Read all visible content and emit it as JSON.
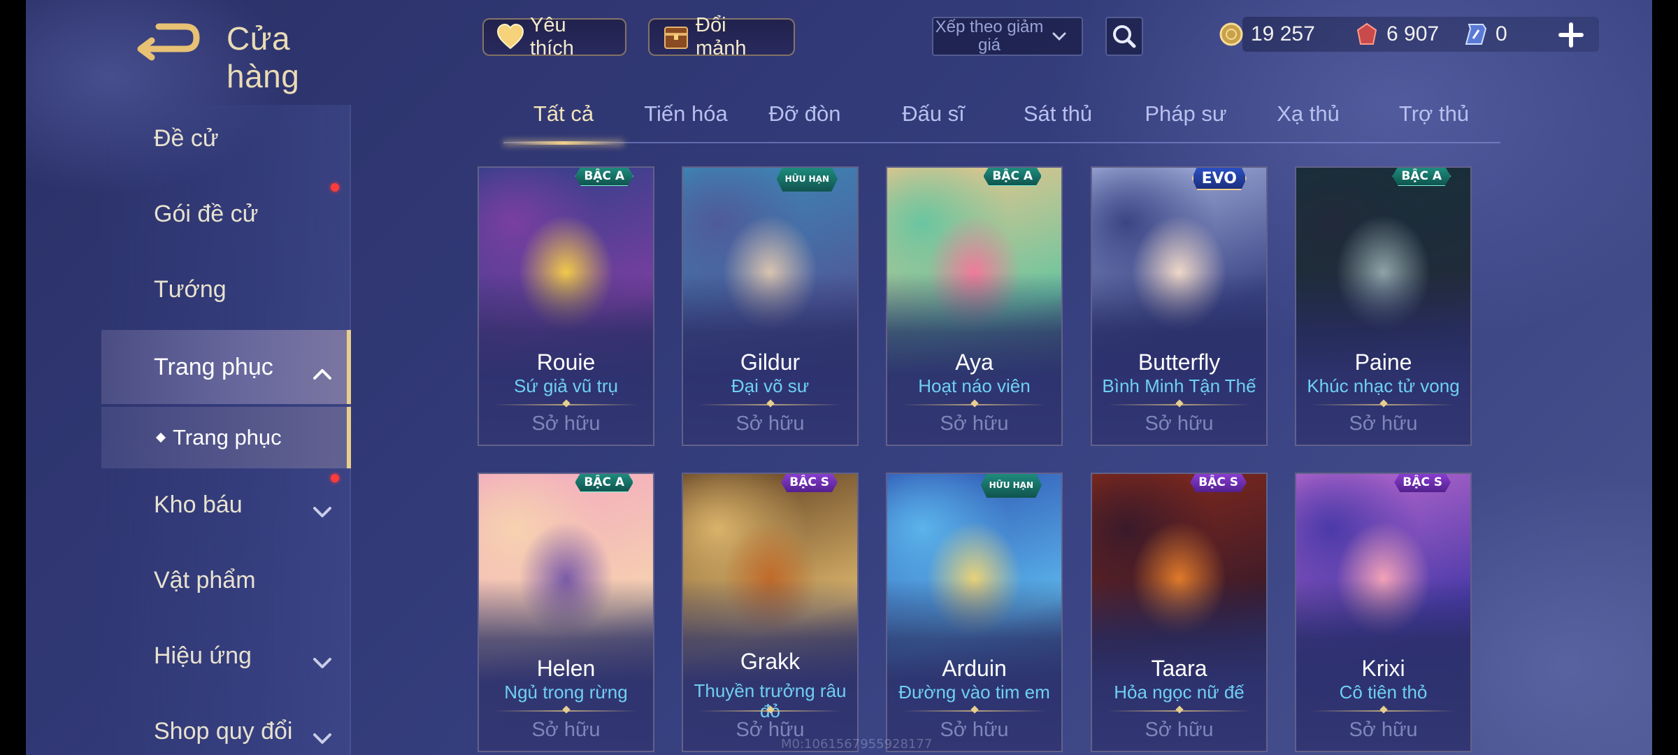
{
  "header": {
    "title": "Cửa hàng",
    "favorite_label": "Yêu thích",
    "exchange_label": "Đổi mảnh",
    "sort_label": "Xếp theo giảm giá",
    "currencies": [
      {
        "icon": "gold-coin-icon",
        "value": "19 257"
      },
      {
        "icon": "voucher-icon",
        "value": "6 907"
      },
      {
        "icon": "quan-huy-icon",
        "value": "0"
      }
    ]
  },
  "sidebar": {
    "items": [
      {
        "label": "Đề cử",
        "has_dot": false,
        "chevron": "none"
      },
      {
        "label": "Gói đề cử",
        "has_dot": true,
        "chevron": "none"
      },
      {
        "label": "Tướng",
        "has_dot": false,
        "chevron": "none"
      },
      {
        "label": "Trang phục",
        "has_dot": false,
        "chevron": "up",
        "active": true
      },
      {
        "label": "Kho báu",
        "has_dot": true,
        "chevron": "down"
      },
      {
        "label": "Vật phẩm",
        "has_dot": false,
        "chevron": "none"
      },
      {
        "label": "Hiệu ứng",
        "has_dot": false,
        "chevron": "down"
      },
      {
        "label": "Shop quy đổi",
        "has_dot": false,
        "chevron": "down"
      }
    ],
    "sub_item": "Trang phục"
  },
  "tabs": [
    {
      "label": "Tất cả",
      "active": true
    },
    {
      "label": "Tiến hóa"
    },
    {
      "label": "Đỡ đòn"
    },
    {
      "label": "Đấu sĩ"
    },
    {
      "label": "Sát thủ"
    },
    {
      "label": "Pháp sư"
    },
    {
      "label": "Xạ thủ"
    },
    {
      "label": "Trợ thủ"
    }
  ],
  "cards": [
    {
      "hero": "Rouie",
      "skin": "Sứ giả vũ trụ",
      "status": "Sở hữu",
      "rank": "BẬC A",
      "rank_type": "a",
      "colors": [
        "#2a3f86",
        "#f2c94a",
        "#7a3fa0"
      ]
    },
    {
      "hero": "Gildur",
      "skin": "Đại võ sư",
      "status": "Sở hữu",
      "rank": "HỮU HẠN",
      "rank_type": "lim",
      "colors": [
        "#3a8cb8",
        "#d9c4b0",
        "#4f5a9a"
      ]
    },
    {
      "hero": "Aya",
      "skin": "Hoạt náo viên",
      "status": "Sở hữu",
      "rank": "BẬC A",
      "rank_type": "a",
      "colors": [
        "#f4c58a",
        "#f07a9a",
        "#69c5a0"
      ]
    },
    {
      "hero": "Butterfly",
      "skin": "Bình Minh Tận Thế",
      "status": "Sở hữu",
      "rank": "EVO",
      "rank_type": "evo",
      "colors": [
        "#aab6e0",
        "#f0d8c8",
        "#3b4585"
      ]
    },
    {
      "hero": "Paine",
      "skin": "Khúc nhạc tử vong",
      "status": "Sở hữu",
      "rank": "BẬC A",
      "rank_type": "a",
      "colors": [
        "#16303a",
        "#8fa3a8",
        "#222a3a"
      ]
    },
    {
      "hero": "Helen",
      "skin": "Ngủ trong rừng",
      "status": "Sở hữu",
      "rank": "BẬC A",
      "rank_type": "a",
      "colors": [
        "#f2a6c0",
        "#7a5aa8",
        "#f6d2b0"
      ]
    },
    {
      "hero": "Grakk",
      "skin": "Thuyền trưởng râu đỏ",
      "status": "Sở hữu",
      "rank": "BẬC S",
      "rank_type": "s",
      "colors": [
        "#5a3a1e",
        "#c06a2a",
        "#d9b36a"
      ]
    },
    {
      "hero": "Arduin",
      "skin": "Đường vào tim em",
      "status": "Sở hữu",
      "rank": "HỮU HẠN",
      "rank_type": "lim",
      "colors": [
        "#2c4fb0",
        "#e8d27a",
        "#5bb4ea"
      ]
    },
    {
      "hero": "Taara",
      "skin": "Hỏa ngọc nữ đế",
      "status": "Sở hữu",
      "rank": "BẬC S",
      "rank_type": "s",
      "colors": [
        "#8a2a1a",
        "#e07a2a",
        "#3a1a2a"
      ]
    },
    {
      "hero": "Krixi",
      "skin": "Cô tiên thỏ",
      "status": "Sở hữu",
      "rank": "BẬC S",
      "rank_type": "s",
      "colors": [
        "#c06ad0",
        "#f3a2b8",
        "#4a3aa8"
      ]
    }
  ],
  "watermark": "M0:1061567955928177"
}
